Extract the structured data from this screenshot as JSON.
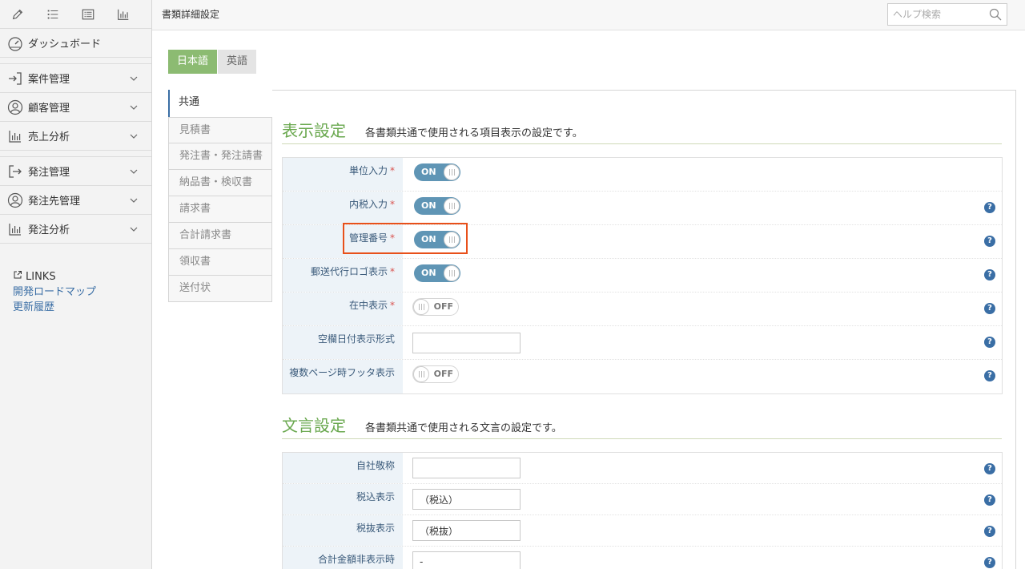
{
  "topbar": {
    "title": "書類詳細設定",
    "search_placeholder": "ヘルプ検索"
  },
  "sidebar": {
    "tools": [
      "pencil-icon",
      "list-icon",
      "table-icon",
      "chart-icon"
    ],
    "items": [
      {
        "label": "ダッシュボード",
        "icon": "speedometer-icon"
      },
      {
        "label": "案件管理",
        "icon": "sign-in-icon"
      },
      {
        "label": "顧客管理",
        "icon": "user-circle-icon"
      },
      {
        "label": "売上分析",
        "icon": "bar-chart-icon"
      },
      {
        "label": "発注管理",
        "icon": "sign-out-icon"
      },
      {
        "label": "発注先管理",
        "icon": "user-circle-icon"
      },
      {
        "label": "発注分析",
        "icon": "bar-chart-icon"
      }
    ],
    "links_heading": "LINKS",
    "links": [
      "開発ロードマップ",
      "更新履歴"
    ]
  },
  "lang_tabs": [
    "日本語",
    "英語"
  ],
  "doc_tabs": [
    "共通",
    "見積書",
    "発注書・発注請書",
    "納品書・検収書",
    "請求書",
    "合計請求書",
    "領収書",
    "送付状"
  ],
  "display": {
    "title": "表示設定",
    "desc": "各書類共通で使用される項目表示の設定です。",
    "rows": [
      {
        "label": "単位入力",
        "required": "*",
        "type": "toggle",
        "value": "ON"
      },
      {
        "label": "内税入力",
        "required": "*",
        "type": "toggle",
        "value": "ON"
      },
      {
        "label": "管理番号",
        "required": "*",
        "type": "toggle",
        "value": "ON"
      },
      {
        "label": "郵送代行ロゴ表示",
        "required": "*",
        "type": "toggle",
        "value": "ON"
      },
      {
        "label": "在中表示",
        "required": "*",
        "type": "toggle",
        "value": "OFF"
      },
      {
        "label": "空欄日付表示形式",
        "type": "text",
        "value": ""
      },
      {
        "label": "複数ページ時フッタ表示",
        "type": "toggle",
        "value": "OFF"
      }
    ]
  },
  "wording": {
    "title": "文言設定",
    "desc": "各書類共通で使用される文言の設定です。",
    "rows": [
      {
        "label": "自社敬称",
        "value": ""
      },
      {
        "label": "税込表示",
        "value": "（税込）"
      },
      {
        "label": "税抜表示",
        "value": "（税抜）"
      },
      {
        "label": "合計金額非表示時",
        "value": "-"
      }
    ]
  },
  "help_glyph": "?",
  "colors": {
    "accent_green": "#8cbb72",
    "title_green": "#6aa84f",
    "toggle_blue": "#5f95b5",
    "highlight": "#e8501a"
  }
}
